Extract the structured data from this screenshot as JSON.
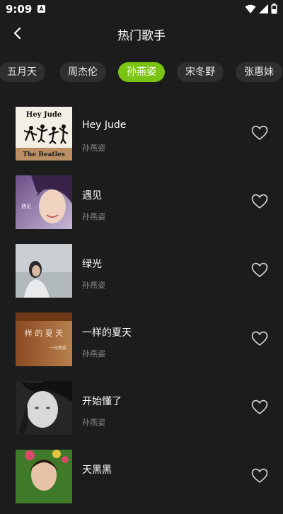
{
  "status": {
    "time": "9:09"
  },
  "header": {
    "title": "热门歌手"
  },
  "singers": [
    "五月天",
    "周杰伦",
    "孙燕姿",
    "宋冬野",
    "张惠妹"
  ],
  "selected_index": 2,
  "accent": "#7cc414",
  "songs": [
    {
      "title": "Hey Jude",
      "artist": "孙燕姿",
      "cover_title": "Hey Jude",
      "cover_sub": "The Beatles"
    },
    {
      "title": "遇见",
      "artist": "孙燕姿",
      "cover_text": "遇见"
    },
    {
      "title": "绿光",
      "artist": "孙燕姿"
    },
    {
      "title": "一样的夏天",
      "artist": "孙燕姿",
      "cover_text": "样 的 夏 天",
      "cover_sub": "一孙燕姿"
    },
    {
      "title": "开始懂了",
      "artist": "孙燕姿"
    },
    {
      "title": "天黑黑",
      "artist": ""
    }
  ],
  "icons": {
    "back": "back-arrow-icon",
    "favorite": "heart-outline-icon"
  }
}
